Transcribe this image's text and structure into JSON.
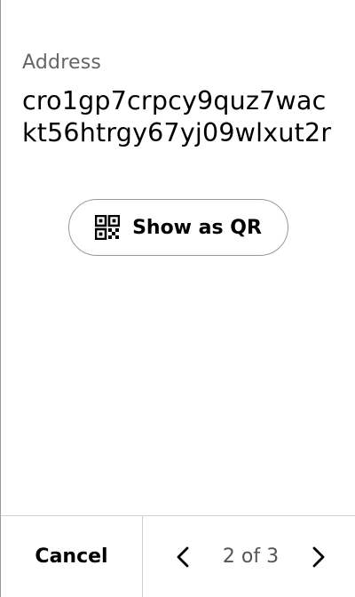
{
  "address": {
    "label": "Address",
    "value": "cro1gp7crpcy9quz7wackt56htrgy67yj09wlxut2r"
  },
  "qr_button": {
    "label": "Show as QR",
    "icon": "qr-code-icon"
  },
  "footer": {
    "cancel_label": "Cancel",
    "pager": {
      "text": "2 of 3",
      "prev_icon": "chevron-left-icon",
      "next_icon": "chevron-right-icon"
    }
  }
}
